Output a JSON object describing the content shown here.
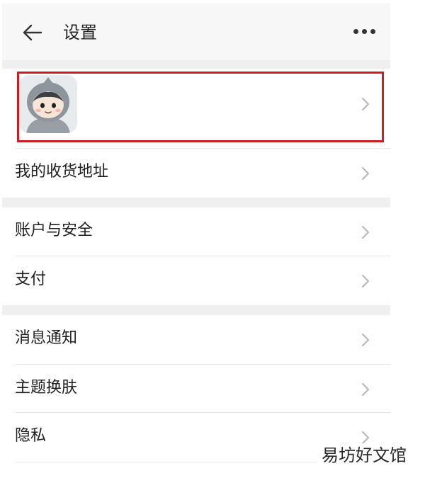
{
  "header": {
    "title": "设置",
    "back_icon": "arrow-left-icon",
    "more_icon": "more-dots-icon"
  },
  "profile": {
    "avatar_icon": "cartoon-avatar",
    "highlight_color": "#c81e22"
  },
  "groups": [
    {
      "items": [
        {
          "label": "我的收货地址"
        }
      ]
    },
    {
      "items": [
        {
          "label": "账户与安全"
        },
        {
          "label": "支付"
        }
      ]
    },
    {
      "items": [
        {
          "label": "消息通知"
        },
        {
          "label": "主题换肤"
        },
        {
          "label": "隐私"
        }
      ]
    }
  ],
  "watermark": "易坊好文馆"
}
